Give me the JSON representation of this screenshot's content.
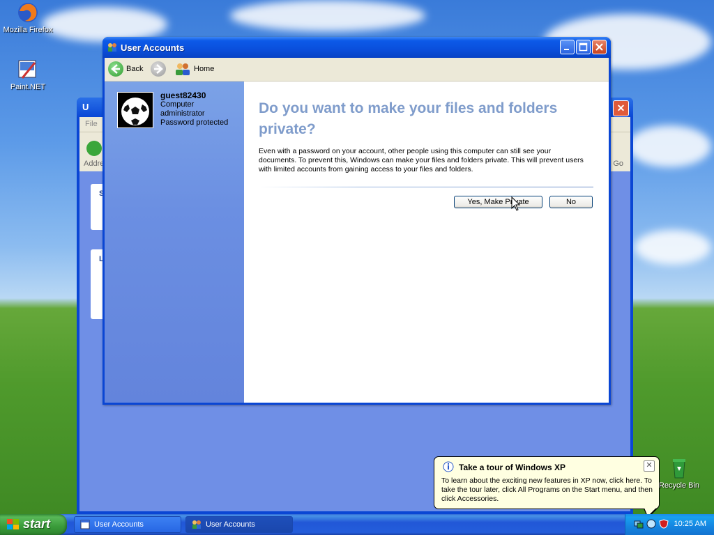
{
  "desktop": {
    "icons": [
      {
        "label": "Mozilla Firefox",
        "icon": "firefox-icon"
      },
      {
        "label": "Paint.NET",
        "icon": "paintnet-icon"
      },
      {
        "label": "Recycle Bin",
        "icon": "recycle-bin-icon"
      }
    ]
  },
  "background_window": {
    "title_fragment": "U",
    "menu_fragment": "File",
    "address_fragment": "Addre",
    "go_label": "Go",
    "panel1_fragment": "S",
    "panel2_fragment": "L"
  },
  "window": {
    "title": "User Accounts",
    "toolbar": {
      "back": "Back",
      "home": "Home"
    },
    "user": {
      "name": "guest82430",
      "role_line1": "Computer",
      "role_line2": "administrator",
      "status": "Password protected"
    },
    "heading": "Do you want to make your files and folders private?",
    "paragraph": "Even with a password on your account, other people using this computer can still see your documents. To prevent this, Windows can make your files and folders private. This will prevent users with limited accounts from gaining access to your files and folders.",
    "buttons": {
      "yes": "Yes, Make Private",
      "no": "No"
    }
  },
  "balloon": {
    "title": "Take a tour of Windows XP",
    "text": "To learn about the exciting new features in XP now, click here. To take the tour later, click All Programs on the Start menu, and then click Accessories."
  },
  "taskbar": {
    "start": "start",
    "tasks": [
      {
        "label": "User Accounts",
        "active": false
      },
      {
        "label": "User Accounts",
        "active": true
      }
    ],
    "clock": "10:25 AM"
  },
  "colors": {
    "title_blue": "#0a4fdc",
    "heading": "#7f9ccb",
    "left_pane": "#6b8fe2",
    "balloon": "#ffffe1",
    "start_green": "#3a9b3a"
  }
}
